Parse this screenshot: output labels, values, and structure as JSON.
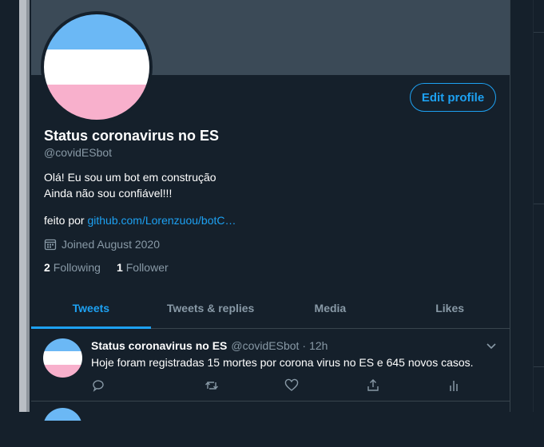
{
  "profile": {
    "name": "Status coronavirus no ES",
    "handle": "@covidESbot",
    "bio_line1": "Olá! Eu sou um bot em construção",
    "bio_line2": "Ainda não sou confiável!!!",
    "made_by_prefix": "feito por ",
    "made_by_link": "github.com/Lorenzuou/botC…",
    "joined": "Joined August 2020",
    "following_count": "2",
    "following_label": "Following",
    "followers_count": "1",
    "followers_label": "Follower",
    "edit_button": "Edit profile"
  },
  "tabs": [
    {
      "label": "Tweets",
      "active": true
    },
    {
      "label": "Tweets & replies",
      "active": false
    },
    {
      "label": "Media",
      "active": false
    },
    {
      "label": "Likes",
      "active": false
    }
  ],
  "tweet": {
    "name": "Status coronavirus no ES",
    "handle": "@covidESbot",
    "separator": "·",
    "time": "12h",
    "text": "Hoje foram registradas 15 mortes por corona virus no ES e 645 novos casos."
  },
  "icons": {
    "calendar": "calendar-icon",
    "reply": "reply-icon",
    "retweet": "retweet-icon",
    "like": "heart-icon",
    "share": "share-icon",
    "analytics": "analytics-icon",
    "chevron": "chevron-down-icon"
  },
  "colors": {
    "background": "#15202b",
    "accent": "#1da1f2",
    "secondary_text": "#8899a6",
    "flag_blue": "#6bb8f5",
    "flag_white": "#ffffff",
    "flag_pink": "#f8b0cc"
  }
}
